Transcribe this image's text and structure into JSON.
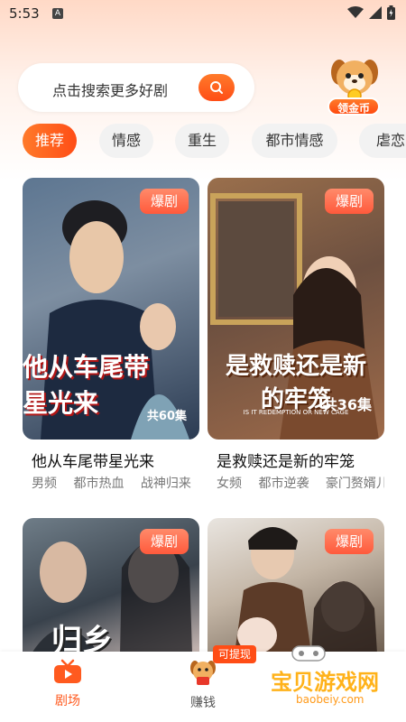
{
  "status": {
    "time": "5:53",
    "notification_icon": "A"
  },
  "search": {
    "placeholder": "点击搜索更多好剧"
  },
  "coin": {
    "label": "领金币"
  },
  "tabs": [
    {
      "label": "推荐",
      "active": true
    },
    {
      "label": "情感"
    },
    {
      "label": "重生"
    },
    {
      "label": "都市情感"
    },
    {
      "label": "虐恋"
    }
  ],
  "dramas": [
    {
      "title": "他从车尾带星光来",
      "badge": "爆剧",
      "episodes": "共60集",
      "poster_title": "他从车尾带星光来",
      "tags": [
        "男频",
        "都市热血",
        "战神归来"
      ]
    },
    {
      "title": "是救赎还是新的牢笼",
      "badge": "爆剧",
      "episodes": "共36集",
      "poster_title": "是救赎还是新的牢笼",
      "poster_subtitle": "IS IT REDEMPTION OR NEW CAGE",
      "tags": [
        "女频",
        "都市逆袭",
        "豪门赘婿儿"
      ]
    },
    {
      "badge": "爆剧",
      "poster_title": "归乡"
    },
    {
      "badge": "爆剧"
    }
  ],
  "bottom_nav": [
    {
      "label": "剧场",
      "icon": "tv-icon",
      "active": true
    },
    {
      "label": "赚钱",
      "icon": "puppy-coin-icon",
      "badge": "可提现"
    }
  ],
  "watermark": {
    "title": "宝贝游戏网",
    "url": "baobeiy.com"
  },
  "colors": {
    "accent": "#ff5a1f",
    "badge": "#ff6a4a"
  }
}
